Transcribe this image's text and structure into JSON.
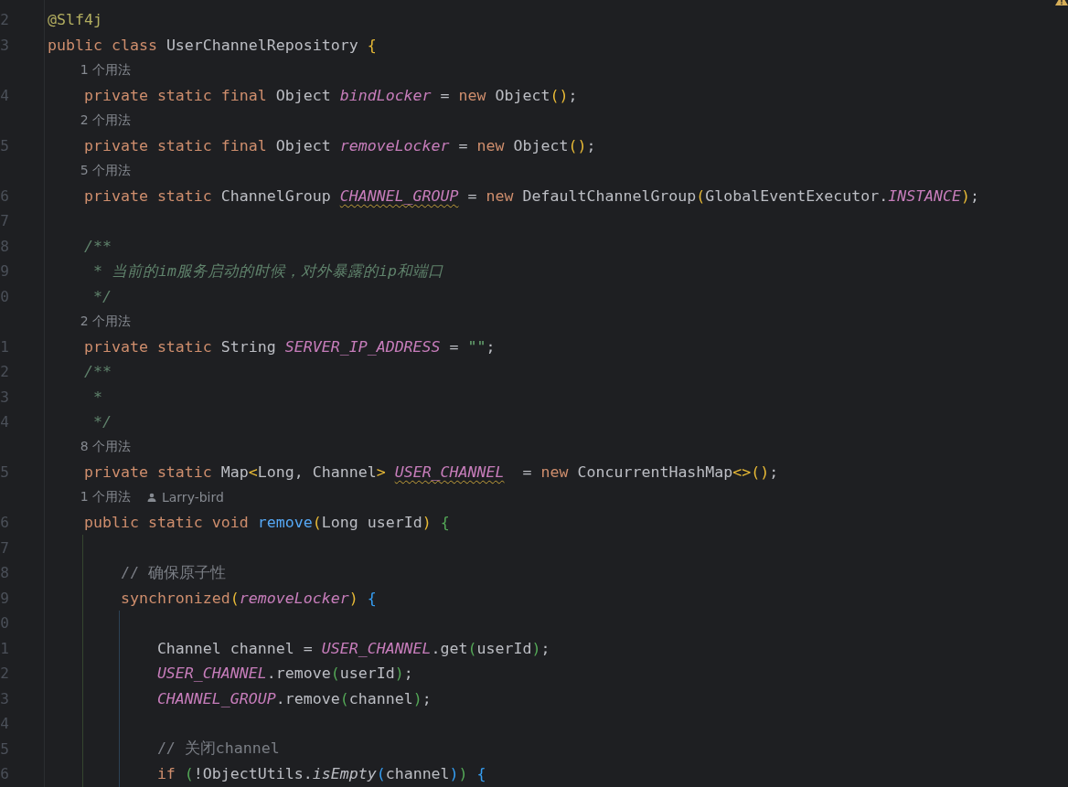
{
  "editor": {
    "rows": [
      {
        "kind": "code",
        "number": "2",
        "tokens": [
          {
            "kind": "annotation",
            "text": "@Slf4j"
          }
        ]
      },
      {
        "kind": "code",
        "number": "3",
        "tokens": [
          {
            "kind": "keyword",
            "text": "public class "
          },
          {
            "kind": "plain",
            "text": "UserChannelRepository "
          },
          {
            "kind": "bracket",
            "text": "{",
            "color": "#e8ba36"
          }
        ]
      },
      {
        "kind": "hint",
        "text": "1 个用法"
      },
      {
        "kind": "code",
        "number": "4",
        "tokens": [
          {
            "kind": "keyword",
            "text": "    private static final "
          },
          {
            "kind": "plain",
            "text": "Object "
          },
          {
            "kind": "field",
            "text": "bindLocker"
          },
          {
            "kind": "plain",
            "text": " = "
          },
          {
            "kind": "keyword",
            "text": "new "
          },
          {
            "kind": "plain",
            "text": "Object"
          },
          {
            "kind": "bracket",
            "text": "()",
            "color": "#e8ba36"
          },
          {
            "kind": "plain",
            "text": ";"
          }
        ]
      },
      {
        "kind": "hint",
        "text": "2 个用法"
      },
      {
        "kind": "code",
        "number": "5",
        "tokens": [
          {
            "kind": "keyword",
            "text": "    private static final "
          },
          {
            "kind": "plain",
            "text": "Object "
          },
          {
            "kind": "field",
            "text": "removeLocker"
          },
          {
            "kind": "plain",
            "text": " = "
          },
          {
            "kind": "keyword",
            "text": "new "
          },
          {
            "kind": "plain",
            "text": "Object"
          },
          {
            "kind": "bracket",
            "text": "()",
            "color": "#e8ba36"
          },
          {
            "kind": "plain",
            "text": ";"
          }
        ]
      },
      {
        "kind": "hint",
        "text": "5 个用法"
      },
      {
        "kind": "code",
        "number": "6",
        "tokens": [
          {
            "kind": "keyword",
            "text": "    private static "
          },
          {
            "kind": "plain",
            "text": "ChannelGroup "
          },
          {
            "kind": "field",
            "text": "CHANNEL_GROUP",
            "warning": true
          },
          {
            "kind": "plain",
            "text": " = "
          },
          {
            "kind": "keyword",
            "text": "new "
          },
          {
            "kind": "plain",
            "text": "DefaultChannelGroup"
          },
          {
            "kind": "bracket",
            "text": "(",
            "color": "#e8ba36"
          },
          {
            "kind": "plain",
            "text": "GlobalEventExecutor."
          },
          {
            "kind": "field",
            "text": "INSTANCE"
          },
          {
            "kind": "bracket",
            "text": ")",
            "color": "#e8ba36"
          },
          {
            "kind": "plain",
            "text": ";"
          }
        ]
      },
      {
        "kind": "code",
        "number": "7"
      },
      {
        "kind": "code",
        "number": "8",
        "tokens": [
          {
            "kind": "doc",
            "text": "    /**"
          }
        ]
      },
      {
        "kind": "code",
        "number": "9",
        "tokens": [
          {
            "kind": "doc",
            "text": "     * 当前的im服务启动的时候，对外暴露的ip和端口"
          }
        ]
      },
      {
        "kind": "code",
        "number": "0",
        "tokens": [
          {
            "kind": "doc",
            "text": "     */"
          }
        ]
      },
      {
        "kind": "hint",
        "text": "2 个用法"
      },
      {
        "kind": "code",
        "number": "1",
        "tokens": [
          {
            "kind": "keyword",
            "text": "    private static "
          },
          {
            "kind": "plain",
            "text": "String "
          },
          {
            "kind": "field",
            "text": "SERVER_IP_ADDRESS"
          },
          {
            "kind": "plain",
            "text": " = "
          },
          {
            "kind": "string",
            "text": "\"\""
          },
          {
            "kind": "plain",
            "text": ";"
          }
        ]
      },
      {
        "kind": "code",
        "number": "2",
        "tokens": [
          {
            "kind": "doc",
            "text": "    /**"
          }
        ]
      },
      {
        "kind": "code",
        "number": "3",
        "tokens": [
          {
            "kind": "doc",
            "text": "     *"
          }
        ]
      },
      {
        "kind": "code",
        "number": "4",
        "tokens": [
          {
            "kind": "doc",
            "text": "     */"
          }
        ]
      },
      {
        "kind": "hint",
        "text": "8 个用法"
      },
      {
        "kind": "code",
        "number": "5",
        "tokens": [
          {
            "kind": "keyword",
            "text": "    private static "
          },
          {
            "kind": "plain",
            "text": "Map"
          },
          {
            "kind": "bracket",
            "text": "<",
            "color": "#e8ba36"
          },
          {
            "kind": "plain",
            "text": "Long, Channel"
          },
          {
            "kind": "bracket",
            "text": "> ",
            "color": "#e8ba36"
          },
          {
            "kind": "field",
            "text": "USER_CHANNEL",
            "warning": true
          },
          {
            "kind": "plain",
            "text": "  = "
          },
          {
            "kind": "keyword",
            "text": "new "
          },
          {
            "kind": "plain",
            "text": "ConcurrentHashMap"
          },
          {
            "kind": "bracket",
            "text": "<>()",
            "color": "#e8ba36"
          },
          {
            "kind": "plain",
            "text": ";"
          }
        ]
      },
      {
        "kind": "hint",
        "text": "1 个用法",
        "author": "Larry-bird"
      },
      {
        "kind": "code",
        "number": "6",
        "tokens": [
          {
            "kind": "keyword",
            "text": "    public static void "
          },
          {
            "kind": "method",
            "text": "remove"
          },
          {
            "kind": "bracket",
            "text": "(",
            "color": "#e8ba36"
          },
          {
            "kind": "plain",
            "text": "Long userId"
          },
          {
            "kind": "bracket",
            "text": ") ",
            "color": "#e8ba36"
          },
          {
            "kind": "bracket",
            "text": "{",
            "color": "#54a857"
          }
        ]
      },
      {
        "kind": "code",
        "number": "7"
      },
      {
        "kind": "code",
        "number": "8",
        "tokens": [
          {
            "kind": "comment",
            "text": "        // 确保原子性"
          }
        ]
      },
      {
        "kind": "code",
        "number": "9",
        "tokens": [
          {
            "kind": "keyword",
            "text": "        synchronized"
          },
          {
            "kind": "bracket",
            "text": "(",
            "color": "#e8ba36"
          },
          {
            "kind": "field",
            "text": "removeLocker"
          },
          {
            "kind": "bracket",
            "text": ") ",
            "color": "#e8ba36"
          },
          {
            "kind": "bracket",
            "text": "{",
            "color": "#359ff4"
          }
        ]
      },
      {
        "kind": "code",
        "number": "0"
      },
      {
        "kind": "code",
        "number": "1",
        "tokens": [
          {
            "kind": "plain",
            "text": "            Channel channel = "
          },
          {
            "kind": "field",
            "text": "USER_CHANNEL"
          },
          {
            "kind": "plain",
            "text": ".get"
          },
          {
            "kind": "bracket",
            "text": "(",
            "color": "#54a857"
          },
          {
            "kind": "plain",
            "text": "userId"
          },
          {
            "kind": "bracket",
            "text": ")",
            "color": "#54a857"
          },
          {
            "kind": "plain",
            "text": ";"
          }
        ]
      },
      {
        "kind": "code",
        "number": "2",
        "tokens": [
          {
            "kind": "field",
            "text": "            USER_CHANNEL"
          },
          {
            "kind": "plain",
            "text": ".remove"
          },
          {
            "kind": "bracket",
            "text": "(",
            "color": "#54a857"
          },
          {
            "kind": "plain",
            "text": "userId"
          },
          {
            "kind": "bracket",
            "text": ")",
            "color": "#54a857"
          },
          {
            "kind": "plain",
            "text": ";"
          }
        ]
      },
      {
        "kind": "code",
        "number": "3",
        "tokens": [
          {
            "kind": "field",
            "text": "            CHANNEL_GROUP"
          },
          {
            "kind": "plain",
            "text": ".remove"
          },
          {
            "kind": "bracket",
            "text": "(",
            "color": "#54a857"
          },
          {
            "kind": "plain",
            "text": "channel"
          },
          {
            "kind": "bracket",
            "text": ")",
            "color": "#54a857"
          },
          {
            "kind": "plain",
            "text": ";"
          }
        ]
      },
      {
        "kind": "code",
        "number": "4"
      },
      {
        "kind": "code",
        "number": "5",
        "tokens": [
          {
            "kind": "comment",
            "text": "            // 关闭channel"
          }
        ]
      },
      {
        "kind": "code",
        "number": "6",
        "tokens": [
          {
            "kind": "keyword",
            "text": "            if "
          },
          {
            "kind": "bracket",
            "text": "(",
            "color": "#54a857"
          },
          {
            "kind": "plain",
            "text": "!ObjectUtils."
          },
          {
            "kind": "static_call",
            "text": "isEmpty"
          },
          {
            "kind": "bracket",
            "text": "(",
            "color": "#359ff4"
          },
          {
            "kind": "plain",
            "text": "channel"
          },
          {
            "kind": "bracket",
            "text": ")",
            "color": "#359ff4"
          },
          {
            "kind": "bracket",
            "text": ") ",
            "color": "#54a857"
          },
          {
            "kind": "bracket",
            "text": "{",
            "color": "#359ff4"
          }
        ]
      }
    ]
  }
}
